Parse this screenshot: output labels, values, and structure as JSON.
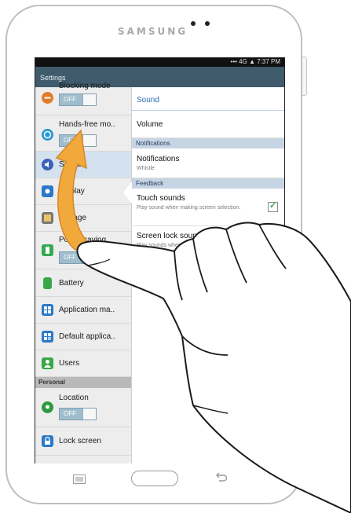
{
  "device": {
    "brand": "SAMSUNG"
  },
  "statusbar": {
    "text": "•••  4G  ▲ 7:37 PM"
  },
  "titlebar": {
    "title": "Settings"
  },
  "left_pane": {
    "items": [
      {
        "label": "Blocking mode",
        "toggle": "OFF",
        "icon": "minus-circle-icon",
        "color": "#e07b2c"
      },
      {
        "label": "Hands-free mo..",
        "toggle": "OFF",
        "icon": "hands-free-icon",
        "color": "#2b98d3"
      },
      {
        "label": "Sound",
        "icon": "speaker-icon",
        "color": "#3a63b8"
      },
      {
        "label": "Display",
        "icon": "display-icon",
        "color": "#2b78c8"
      },
      {
        "label": "Storage",
        "icon": "storage-icon",
        "color": "#777777"
      },
      {
        "label": "Power saving",
        "toggle": "OFF",
        "icon": "power-saving-icon",
        "color": "#34a853"
      },
      {
        "label": "Battery",
        "icon": "battery-icon",
        "color": "#3aa64a"
      },
      {
        "label": "Application ma..",
        "icon": "apps-grid-icon",
        "color": "#2b78c8"
      },
      {
        "label": "Default applica..",
        "icon": "default-apps-icon",
        "color": "#2b78c8"
      },
      {
        "label": "Users",
        "icon": "user-icon",
        "color": "#3aa64a"
      }
    ],
    "section_personal": "Personal",
    "personal_items": [
      {
        "label": "Location",
        "toggle": "OFF",
        "icon": "location-icon",
        "color": "#2e9a3d"
      },
      {
        "label": "Lock screen",
        "icon": "lock-screen-icon",
        "color": "#2b78c8"
      }
    ]
  },
  "right_pane": {
    "header": "Sound",
    "volume_label": "Volume",
    "section_notifications": "Notifications",
    "notifications": {
      "title": "Notifications",
      "sub": "Whistle"
    },
    "section_feedback": "Feedback",
    "touch_sounds": {
      "title": "Touch sounds",
      "sub": "Play sound when making screen selection.",
      "checked": true
    },
    "screen_lock_sound": {
      "title": "Screen lock sound",
      "sub": "Play sounds when locking and unlocking screen."
    }
  },
  "colors": {
    "titlebar": "#3f5b6c",
    "accent_text": "#2b6fb3",
    "section_bar": "#c6d4e3",
    "toggle_off": "#9fbdcd",
    "gesture_arrow": "#f2a93c"
  }
}
